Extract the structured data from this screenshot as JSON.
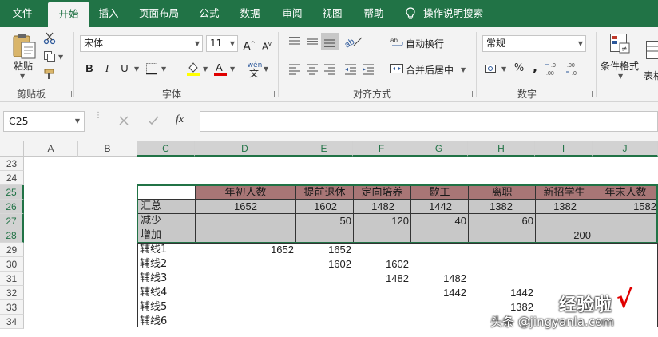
{
  "tabs": [
    "文件",
    "开始",
    "插入",
    "页面布局",
    "公式",
    "数据",
    "审阅",
    "视图",
    "帮助"
  ],
  "active_tab": "开始",
  "tell_me": "操作说明搜索",
  "clipboard": {
    "paste_label": "粘贴",
    "group_label": "剪贴板"
  },
  "font": {
    "name": "宋体",
    "size": "11",
    "bold": "B",
    "italic": "I",
    "underline": "U",
    "group_label": "字体",
    "phonetic": "wén"
  },
  "alignment": {
    "wrap_text": "自动换行",
    "merge_center": "合并后居中",
    "group_label": "对齐方式"
  },
  "number": {
    "format": "常规",
    "percent": "%",
    "comma": ",",
    "group_label": "数字"
  },
  "styles": {
    "conditional_format": "条件格式",
    "table_partial": "表格"
  },
  "name_box": "C25",
  "fx_label": "fx",
  "columns": [
    "A",
    "B",
    "C",
    "D",
    "E",
    "F",
    "G",
    "H",
    "I",
    "J"
  ],
  "rows": [
    "23",
    "24",
    "25",
    "26",
    "27",
    "28",
    "29",
    "30",
    "31",
    "32",
    "33",
    "34"
  ],
  "table": {
    "headers": [
      "年初人数",
      "提前退休",
      "定向培养",
      "歇工",
      "离职",
      "新招学生",
      "年末人数"
    ],
    "row_labels": [
      "汇总",
      "减少",
      "增加"
    ],
    "summary": [
      "1652",
      "1602",
      "1482",
      "1442",
      "1382",
      "1382",
      "1582"
    ],
    "decrease": {
      "E": "50",
      "F": "120",
      "G": "40",
      "H": "60"
    },
    "increase": {
      "I": "200"
    }
  },
  "helper": {
    "labels": [
      "辅线1",
      "辅线2",
      "辅线3",
      "辅线4",
      "辅线5",
      "辅线6"
    ],
    "r29": {
      "D": "1652",
      "E": "1652"
    },
    "r30": {
      "E": "1602",
      "F": "1602"
    },
    "r31": {
      "F": "1482",
      "G": "1482"
    },
    "r32": {
      "G": "1442",
      "H": "1442"
    },
    "r33": {
      "H": "1382"
    }
  },
  "watermark": {
    "line1": "经验啦",
    "check": "√",
    "line2": "头条 @jingyanla.com"
  },
  "colors": {
    "ribbon_green": "#217346",
    "header_fill": "#a87676",
    "gray_fill": "#c8c8c8"
  }
}
